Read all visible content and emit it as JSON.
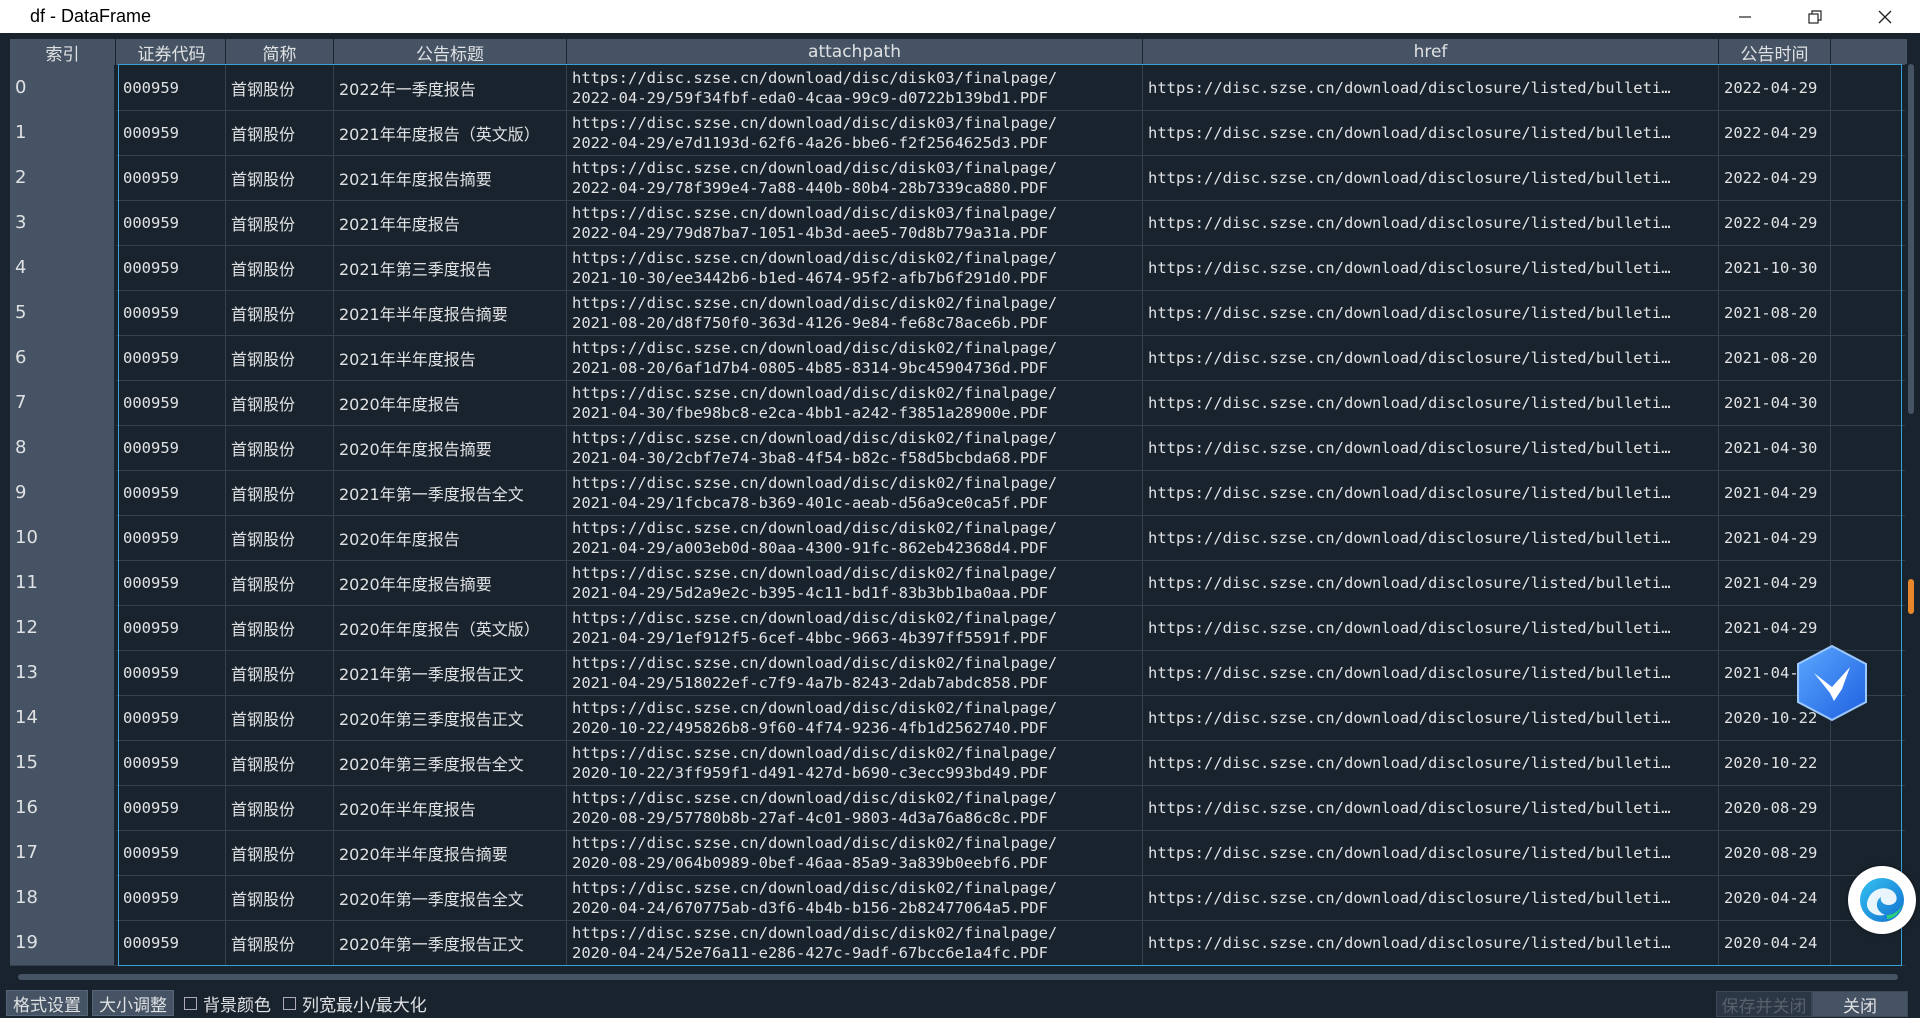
{
  "window": {
    "title": "df - DataFrame",
    "minimize_icon": "minimize-icon",
    "restore_icon": "restore-icon",
    "close_icon": "close-icon"
  },
  "columns": [
    "索引",
    "证券代码",
    "简称",
    "公告标题",
    "attachpath",
    "href",
    "公告时间"
  ],
  "rows": [
    {
      "index": "0",
      "code": "000959",
      "name": "首钢股份",
      "title": "2022年一季度报告",
      "attach1": "https://disc.szse.cn/download/disc/disk03/finalpage/",
      "attach2": "2022-04-29/59f34fbf-eda0-4caa-99c9-d0722b139bd1.PDF",
      "href": "https://disc.szse.cn/download/disclosure/listed/bulleti…",
      "date": "2022-04-29"
    },
    {
      "index": "1",
      "code": "000959",
      "name": "首钢股份",
      "title": "2021年年度报告（英文版）",
      "attach1": "https://disc.szse.cn/download/disc/disk03/finalpage/",
      "attach2": "2022-04-29/e7d1193d-62f6-4a26-bbe6-f2f2564625d3.PDF",
      "href": "https://disc.szse.cn/download/disclosure/listed/bulleti…",
      "date": "2022-04-29"
    },
    {
      "index": "2",
      "code": "000959",
      "name": "首钢股份",
      "title": "2021年年度报告摘要",
      "attach1": "https://disc.szse.cn/download/disc/disk03/finalpage/",
      "attach2": "2022-04-29/78f399e4-7a88-440b-80b4-28b7339ca880.PDF",
      "href": "https://disc.szse.cn/download/disclosure/listed/bulleti…",
      "date": "2022-04-29"
    },
    {
      "index": "3",
      "code": "000959",
      "name": "首钢股份",
      "title": "2021年年度报告",
      "attach1": "https://disc.szse.cn/download/disc/disk03/finalpage/",
      "attach2": "2022-04-29/79d87ba7-1051-4b3d-aee5-70d8b779a31a.PDF",
      "href": "https://disc.szse.cn/download/disclosure/listed/bulleti…",
      "date": "2022-04-29"
    },
    {
      "index": "4",
      "code": "000959",
      "name": "首钢股份",
      "title": "2021年第三季度报告",
      "attach1": "https://disc.szse.cn/download/disc/disk02/finalpage/",
      "attach2": "2021-10-30/ee3442b6-b1ed-4674-95f2-afb7b6f291d0.PDF",
      "href": "https://disc.szse.cn/download/disclosure/listed/bulleti…",
      "date": "2021-10-30"
    },
    {
      "index": "5",
      "code": "000959",
      "name": "首钢股份",
      "title": "2021年半年度报告摘要",
      "attach1": "https://disc.szse.cn/download/disc/disk02/finalpage/",
      "attach2": "2021-08-20/d8f750f0-363d-4126-9e84-fe68c78ace6b.PDF",
      "href": "https://disc.szse.cn/download/disclosure/listed/bulleti…",
      "date": "2021-08-20"
    },
    {
      "index": "6",
      "code": "000959",
      "name": "首钢股份",
      "title": "2021年半年度报告",
      "attach1": "https://disc.szse.cn/download/disc/disk02/finalpage/",
      "attach2": "2021-08-20/6af1d7b4-0805-4b85-8314-9bc45904736d.PDF",
      "href": "https://disc.szse.cn/download/disclosure/listed/bulleti…",
      "date": "2021-08-20"
    },
    {
      "index": "7",
      "code": "000959",
      "name": "首钢股份",
      "title": "2020年年度报告",
      "attach1": "https://disc.szse.cn/download/disc/disk02/finalpage/",
      "attach2": "2021-04-30/fbe98bc8-e2ca-4bb1-a242-f3851a28900e.PDF",
      "href": "https://disc.szse.cn/download/disclosure/listed/bulleti…",
      "date": "2021-04-30"
    },
    {
      "index": "8",
      "code": "000959",
      "name": "首钢股份",
      "title": "2020年年度报告摘要",
      "attach1": "https://disc.szse.cn/download/disc/disk02/finalpage/",
      "attach2": "2021-04-30/2cbf7e74-3ba8-4f54-b82c-f58d5bcbda68.PDF",
      "href": "https://disc.szse.cn/download/disclosure/listed/bulleti…",
      "date": "2021-04-30"
    },
    {
      "index": "9",
      "code": "000959",
      "name": "首钢股份",
      "title": "2021年第一季度报告全文",
      "attach1": "https://disc.szse.cn/download/disc/disk02/finalpage/",
      "attach2": "2021-04-29/1fcbca78-b369-401c-aeab-d56a9ce0ca5f.PDF",
      "href": "https://disc.szse.cn/download/disclosure/listed/bulleti…",
      "date": "2021-04-29"
    },
    {
      "index": "10",
      "code": "000959",
      "name": "首钢股份",
      "title": "2020年年度报告",
      "attach1": "https://disc.szse.cn/download/disc/disk02/finalpage/",
      "attach2": "2021-04-29/a003eb0d-80aa-4300-91fc-862eb42368d4.PDF",
      "href": "https://disc.szse.cn/download/disclosure/listed/bulleti…",
      "date": "2021-04-29"
    },
    {
      "index": "11",
      "code": "000959",
      "name": "首钢股份",
      "title": "2020年年度报告摘要",
      "attach1": "https://disc.szse.cn/download/disc/disk02/finalpage/",
      "attach2": "2021-04-29/5d2a9e2c-b395-4c11-bd1f-83b3bb1ba0aa.PDF",
      "href": "https://disc.szse.cn/download/disclosure/listed/bulleti…",
      "date": "2021-04-29"
    },
    {
      "index": "12",
      "code": "000959",
      "name": "首钢股份",
      "title": "2020年年度报告（英文版）",
      "attach1": "https://disc.szse.cn/download/disc/disk02/finalpage/",
      "attach2": "2021-04-29/1ef912f5-6cef-4bbc-9663-4b397ff5591f.PDF",
      "href": "https://disc.szse.cn/download/disclosure/listed/bulleti…",
      "date": "2021-04-29"
    },
    {
      "index": "13",
      "code": "000959",
      "name": "首钢股份",
      "title": "2021年第一季度报告正文",
      "attach1": "https://disc.szse.cn/download/disc/disk02/finalpage/",
      "attach2": "2021-04-29/518022ef-c7f9-4a7b-8243-2dab7abdc858.PDF",
      "href": "https://disc.szse.cn/download/disclosure/listed/bulleti…",
      "date": "2021-04-"
    },
    {
      "index": "14",
      "code": "000959",
      "name": "首钢股份",
      "title": "2020年第三季度报告正文",
      "attach1": "https://disc.szse.cn/download/disc/disk02/finalpage/",
      "attach2": "2020-10-22/495826b8-9f60-4f74-9236-4fb1d2562740.PDF",
      "href": "https://disc.szse.cn/download/disclosure/listed/bulleti…",
      "date": "2020-10-22"
    },
    {
      "index": "15",
      "code": "000959",
      "name": "首钢股份",
      "title": "2020年第三季度报告全文",
      "attach1": "https://disc.szse.cn/download/disc/disk02/finalpage/",
      "attach2": "2020-10-22/3ff959f1-d491-427d-b690-c3ecc993bd49.PDF",
      "href": "https://disc.szse.cn/download/disclosure/listed/bulleti…",
      "date": "2020-10-22"
    },
    {
      "index": "16",
      "code": "000959",
      "name": "首钢股份",
      "title": "2020年半年度报告",
      "attach1": "https://disc.szse.cn/download/disc/disk02/finalpage/",
      "attach2": "2020-08-29/57780b8b-27af-4c01-9803-4d3a76a86c8c.PDF",
      "href": "https://disc.szse.cn/download/disclosure/listed/bulleti…",
      "date": "2020-08-29"
    },
    {
      "index": "17",
      "code": "000959",
      "name": "首钢股份",
      "title": "2020年半年度报告摘要",
      "attach1": "https://disc.szse.cn/download/disc/disk02/finalpage/",
      "attach2": "2020-08-29/064b0989-0bef-46aa-85a9-3a839b0eebf6.PDF",
      "href": "https://disc.szse.cn/download/disclosure/listed/bulleti…",
      "date": "2020-08-29"
    },
    {
      "index": "18",
      "code": "000959",
      "name": "首钢股份",
      "title": "2020年第一季度报告全文",
      "attach1": "https://disc.szse.cn/download/disc/disk02/finalpage/",
      "attach2": "2020-04-24/670775ab-d3f6-4b4b-b156-2b82477064a5.PDF",
      "href": "https://disc.szse.cn/download/disclosure/listed/bulleti…",
      "date": "2020-04-24"
    },
    {
      "index": "19",
      "code": "000959",
      "name": "首钢股份",
      "title": "2020年第一季度报告正文",
      "attach1": "https://disc.szse.cn/download/disc/disk02/finalpage/",
      "attach2": "2020-04-24/52e76a11-e286-427c-9adf-67bcc6e1a4fc.PDF",
      "href": "https://disc.szse.cn/download/disclosure/listed/bulleti…",
      "date": "2020-04-24"
    }
  ],
  "bottom": {
    "format_button": "格式设置",
    "resize_button": "大小调整",
    "bgcolor_checkbox": "背景颜色",
    "colwidth_checkbox": "列宽最小/最大化",
    "save_close_button": "保存并关闭",
    "close_button": "关闭"
  },
  "colors": {
    "background": "#19232d",
    "header": "#455364",
    "grid_line": "#32414b",
    "selection": "#3a9fd6"
  }
}
